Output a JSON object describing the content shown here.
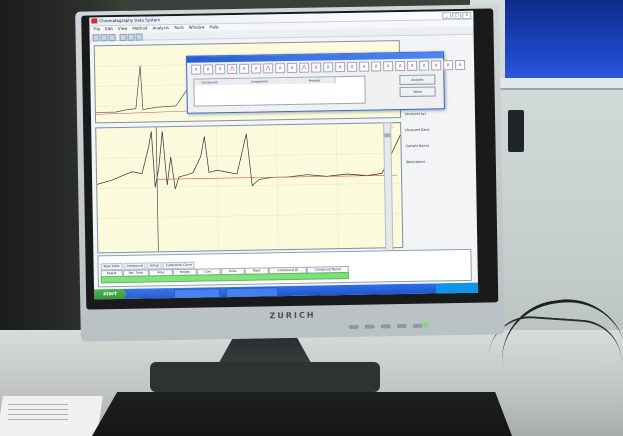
{
  "screen": {
    "window_title": "Chromatography Data System",
    "menu": [
      "File",
      "Edit",
      "View",
      "Method",
      "Analysis",
      "Tools",
      "Window",
      "Help"
    ],
    "dialog": {
      "columns": [
        "Compound",
        "Component",
        "Process"
      ],
      "buttons": [
        "Analysis",
        "Done"
      ]
    },
    "info_labels": [
      "[Analyzed by]",
      "[Analyzed Date]",
      "[Sample Name]",
      "[Description]"
    ],
    "results": {
      "tabs": [
        "Peak Table",
        "Compound",
        "Group",
        "Calibration Curve"
      ],
      "columns": [
        "Peak#",
        "Ret. Time",
        "Area",
        "Height",
        "Conc.",
        "Units",
        "Mark",
        "Compound ID",
        "Compound Name"
      ]
    },
    "taskbar": {
      "start_label": "start"
    }
  },
  "monitor": {
    "brand": "ZURICH"
  }
}
